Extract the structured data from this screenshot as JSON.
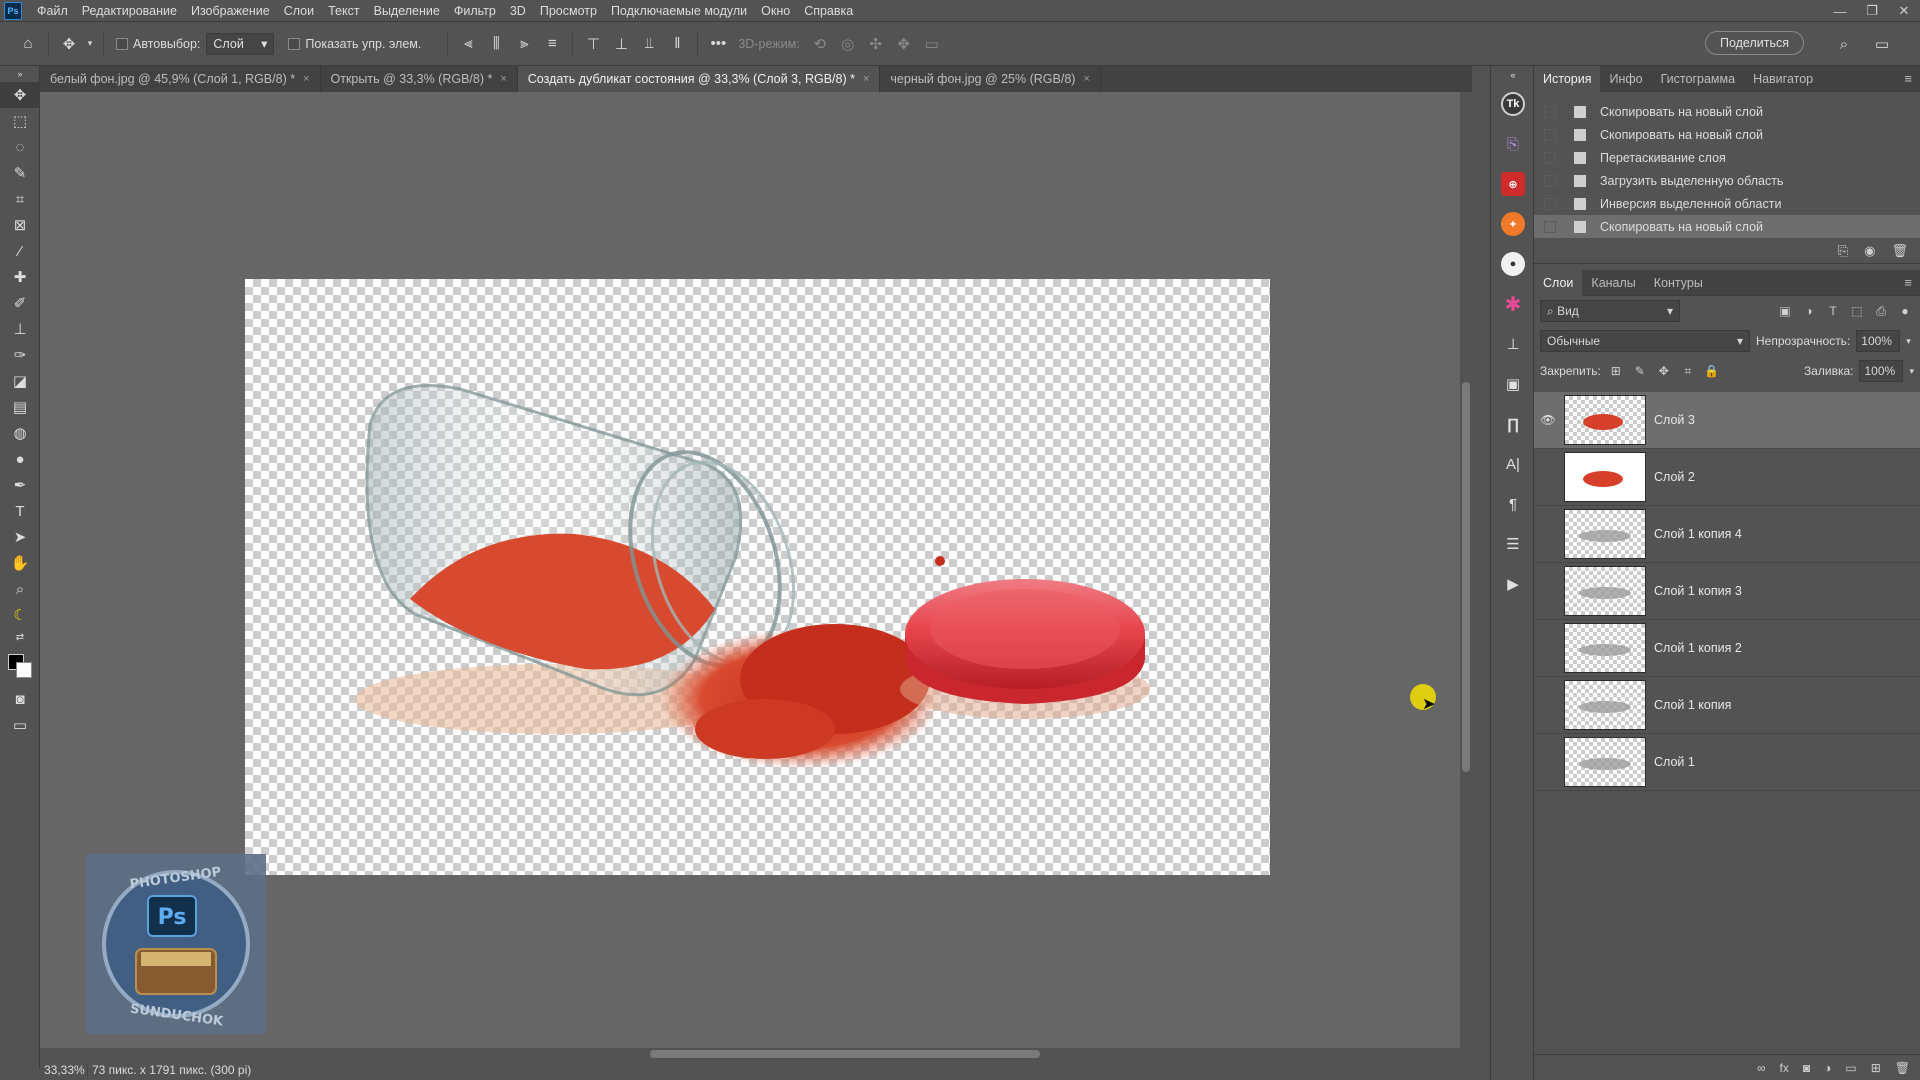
{
  "menubar": {
    "logo": "Ps",
    "items": [
      "Файл",
      "Редактирование",
      "Изображение",
      "Слои",
      "Текст",
      "Выделение",
      "Фильтр",
      "3D",
      "Просмотр",
      "Подключаемые модули",
      "Окно",
      "Справка"
    ]
  },
  "optionsbar": {
    "autoselect_label": "Автовыбор:",
    "autoselect_value": "Слой",
    "show_controls_label": "Показать упр. элем.",
    "mode3d_label": "3D-режим:",
    "share_label": "Поделиться"
  },
  "tabs": [
    {
      "label": "белый фон.jpg @ 45,9% (Слой 1, RGB/8) *",
      "active": false
    },
    {
      "label": "Открыть @ 33,3% (RGB/8) *",
      "active": false
    },
    {
      "label": "Создать дубликат состояния @ 33,3% (Слой 3, RGB/8) *",
      "active": true
    },
    {
      "label": "черный фон.jpg @ 25% (RGB/8)",
      "active": false
    }
  ],
  "statusbar": {
    "zoom": "33,33%",
    "doc_info": "73 пикс. x 1791 пикс. (300 pi)"
  },
  "watermark": {
    "text_top": "PHOTOSHOP",
    "text_bottom": "SUNDUCHOK",
    "badge": "Ps"
  },
  "history_panel": {
    "tabs": [
      "История",
      "Инфо",
      "Гистограмма",
      "Навигатор"
    ],
    "items": [
      {
        "label": "Скопировать на новый слой",
        "selected": false
      },
      {
        "label": "Скопировать на новый слой",
        "selected": false
      },
      {
        "label": "Перетаскивание слоя",
        "selected": false
      },
      {
        "label": "Загрузить выделенную область",
        "selected": false
      },
      {
        "label": "Инверсия выделенной области",
        "selected": false
      },
      {
        "label": "Скопировать на новый слой",
        "selected": true
      }
    ]
  },
  "layers_panel": {
    "tabs": [
      "Слои",
      "Каналы",
      "Контуры"
    ],
    "kind_filter": "Вид",
    "blend_mode": "Обычные",
    "opacity_label": "Непрозрачность:",
    "opacity_value": "100%",
    "lock_label": "Закрепить:",
    "fill_label": "Заливка:",
    "fill_value": "100%",
    "layers": [
      {
        "name": "Слой 3",
        "visible": true,
        "selected": true,
        "thumb": "red"
      },
      {
        "name": "Слой 2",
        "visible": false,
        "selected": false,
        "thumb": "red-white"
      },
      {
        "name": "Слой 1 копия 4",
        "visible": false,
        "selected": false,
        "thumb": "gray"
      },
      {
        "name": "Слой 1 копия 3",
        "visible": false,
        "selected": false,
        "thumb": "gray"
      },
      {
        "name": "Слой 1 копия 2",
        "visible": false,
        "selected": false,
        "thumb": "gray"
      },
      {
        "name": "Слой 1 копия",
        "visible": false,
        "selected": false,
        "thumb": "gray"
      },
      {
        "name": "Слой 1",
        "visible": false,
        "selected": false,
        "thumb": "gray"
      }
    ]
  },
  "colors": {
    "accent_red": "#d6402b",
    "cursor_highlight": "#f4e000",
    "ui_bg": "#535353",
    "canvas_bg": "#666666"
  }
}
